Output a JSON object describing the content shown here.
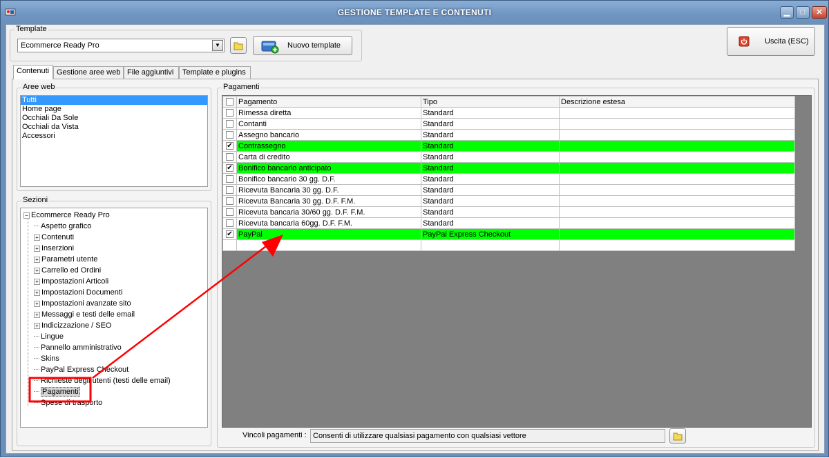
{
  "window": {
    "title": "GESTIONE TEMPLATE E CONTENUTI"
  },
  "template_group": {
    "label": "Template",
    "selected": "Ecommerce Ready Pro",
    "new_button": "Nuovo template"
  },
  "exit_button": "Uscita (ESC)",
  "tabs": [
    "Contenuti",
    "Gestione aree web",
    "File aggiuntivi",
    "Template e plugins"
  ],
  "aree_web": {
    "label": "Aree web",
    "items": [
      "Tutti",
      "Home page",
      "Occhiali Da Sole",
      "Occhiali da Vista",
      "Accessori"
    ]
  },
  "sezioni": {
    "label": "Sezioni",
    "root": "Ecommerce Ready Pro",
    "items": [
      {
        "label": "Aspetto grafico",
        "expandable": false
      },
      {
        "label": "Contenuti",
        "expandable": true
      },
      {
        "label": "Inserzioni",
        "expandable": true
      },
      {
        "label": "Parametri utente",
        "expandable": true
      },
      {
        "label": "Carrello ed Ordini",
        "expandable": true
      },
      {
        "label": "Impostazioni Articoli",
        "expandable": true
      },
      {
        "label": "Impostazioni Documenti",
        "expandable": true
      },
      {
        "label": "Impostazioni avanzate sito",
        "expandable": true
      },
      {
        "label": "Messaggi e testi delle email",
        "expandable": true
      },
      {
        "label": "Indicizzazione / SEO",
        "expandable": true
      },
      {
        "label": "Lingue",
        "expandable": false
      },
      {
        "label": "Pannello amministrativo",
        "expandable": false
      },
      {
        "label": "Skins",
        "expandable": false
      },
      {
        "label": "PayPal Express Checkout",
        "expandable": false
      },
      {
        "label": "Richieste degli utenti (testi delle email)",
        "expandable": false
      },
      {
        "label": "Pagamenti",
        "expandable": false,
        "selected": true
      },
      {
        "label": "Spese di trasporto",
        "expandable": false
      }
    ]
  },
  "pagamenti": {
    "label": "Pagamenti",
    "columns": [
      "Pagamento",
      "Tipo",
      "Descrizione estesa"
    ],
    "rows": [
      {
        "name": "Rimessa diretta",
        "tipo": "Standard",
        "descr": "",
        "checked": false
      },
      {
        "name": "Contanti",
        "tipo": "Standard",
        "descr": "",
        "checked": false
      },
      {
        "name": "Assegno bancario",
        "tipo": "Standard",
        "descr": "",
        "checked": false
      },
      {
        "name": "Contrassegno",
        "tipo": "Standard",
        "descr": "",
        "checked": true
      },
      {
        "name": "Carta di credito",
        "tipo": "Standard",
        "descr": "",
        "checked": false
      },
      {
        "name": "Bonifico bancario anticipato",
        "tipo": "Standard",
        "descr": "",
        "checked": true
      },
      {
        "name": "Bonifico bancario 30 gg. D.F.",
        "tipo": "Standard",
        "descr": "",
        "checked": false
      },
      {
        "name": "Ricevuta Bancaria 30 gg. D.F.",
        "tipo": "Standard",
        "descr": "",
        "checked": false
      },
      {
        "name": "Ricevuta Bancaria 30 gg. D.F. F.M.",
        "tipo": "Standard",
        "descr": "",
        "checked": false
      },
      {
        "name": "Ricevuta bancaria 30/60 gg. D.F. F.M.",
        "tipo": "Standard",
        "descr": "",
        "checked": false
      },
      {
        "name": "Ricevuta bancaria 60gg. D.F. F.M.",
        "tipo": "Standard",
        "descr": "",
        "checked": false
      },
      {
        "name": "PayPal",
        "tipo": "PayPal Express Checkout",
        "descr": "",
        "checked": true
      }
    ]
  },
  "vincoli": {
    "label": "Vincoli pagamenti :",
    "value": "Consenti di utilizzare qualsiasi pagamento con qualsiasi vettore"
  },
  "colors": {
    "checked_row": "#00ff00",
    "selection": "#3399ff",
    "annotation": "#ff0000",
    "grid_bg": "#808080"
  }
}
